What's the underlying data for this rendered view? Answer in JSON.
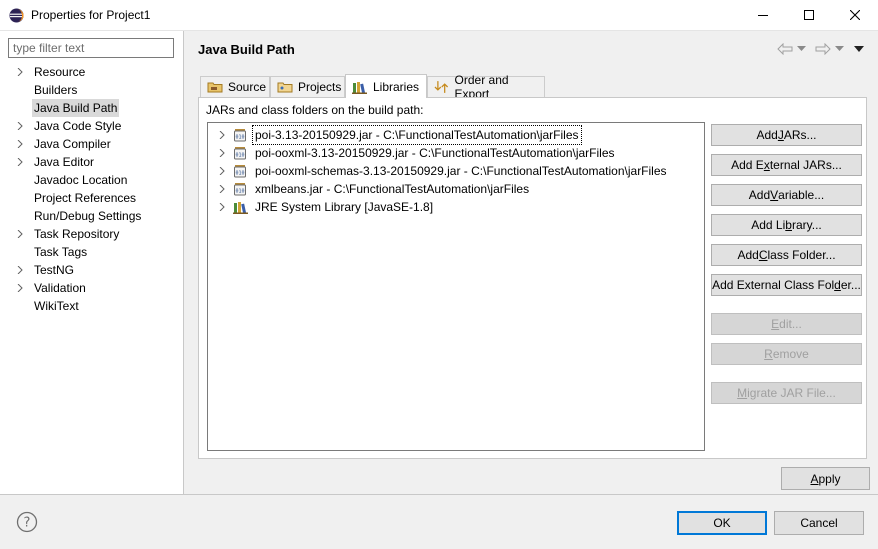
{
  "window": {
    "title": "Properties for Project1"
  },
  "filter": {
    "placeholder": "type filter text"
  },
  "sidebar": {
    "items": [
      {
        "label": "Resource",
        "expandable": true
      },
      {
        "label": "Builders",
        "expandable": false
      },
      {
        "label": "Java Build Path",
        "expandable": false,
        "selected": true
      },
      {
        "label": "Java Code Style",
        "expandable": true
      },
      {
        "label": "Java Compiler",
        "expandable": true
      },
      {
        "label": "Java Editor",
        "expandable": true
      },
      {
        "label": "Javadoc Location",
        "expandable": false
      },
      {
        "label": "Project References",
        "expandable": false
      },
      {
        "label": "Run/Debug Settings",
        "expandable": false
      },
      {
        "label": "Task Repository",
        "expandable": true
      },
      {
        "label": "Task Tags",
        "expandable": false
      },
      {
        "label": "TestNG",
        "expandable": true
      },
      {
        "label": "Validation",
        "expandable": true
      },
      {
        "label": "WikiText",
        "expandable": false
      }
    ]
  },
  "page": {
    "title": "Java Build Path"
  },
  "tabs": [
    {
      "label": "Source",
      "icon": "source-folder-icon"
    },
    {
      "label": "Projects",
      "icon": "projects-icon"
    },
    {
      "label": "Libraries",
      "icon": "libraries-icon",
      "active": true
    },
    {
      "label": "Order and Export",
      "icon": "order-export-icon"
    }
  ],
  "libraries": {
    "caption": "JARs and class folders on the build path:",
    "entries": [
      {
        "label": "poi-3.13-20150929.jar - C:\\FunctionalTestAutomation\\jarFiles",
        "icon": "jar-icon"
      },
      {
        "label": "poi-ooxml-3.13-20150929.jar - C:\\FunctionalTestAutomation\\jarFiles",
        "icon": "jar-icon"
      },
      {
        "label": "poi-ooxml-schemas-3.13-20150929.jar - C:\\FunctionalTestAutomation\\jarFiles",
        "icon": "jar-icon"
      },
      {
        "label": "xmlbeans.jar - C:\\FunctionalTestAutomation\\jarFiles",
        "icon": "jar-icon"
      },
      {
        "label": "JRE System Library [JavaSE-1.8]",
        "icon": "jre-library-icon"
      }
    ]
  },
  "buttons": {
    "add_jars": {
      "pre": "Add ",
      "key": "J",
      "post": "ARs..."
    },
    "add_external_jars": {
      "pre": "Add E",
      "key": "x",
      "post": "ternal JARs..."
    },
    "add_variable": {
      "pre": "Add ",
      "key": "V",
      "post": "ariable..."
    },
    "add_library": {
      "pre": "Add Li",
      "key": "b",
      "post": "rary..."
    },
    "add_class_folder": {
      "pre": "Add ",
      "key": "C",
      "post": "lass Folder..."
    },
    "add_external_class_folder": {
      "pre": "Add External Class Fol",
      "key": "d",
      "post": "er..."
    },
    "edit": {
      "pre": "",
      "key": "E",
      "post": "dit..."
    },
    "remove": {
      "pre": "",
      "key": "R",
      "post": "emove"
    },
    "migrate": {
      "pre": "",
      "key": "M",
      "post": "igrate JAR File..."
    },
    "apply": {
      "pre": "",
      "key": "A",
      "post": "pply"
    },
    "ok": "OK",
    "cancel": "Cancel"
  },
  "colors": {
    "accent": "#0078d7",
    "selection": "#d9d9d9"
  }
}
